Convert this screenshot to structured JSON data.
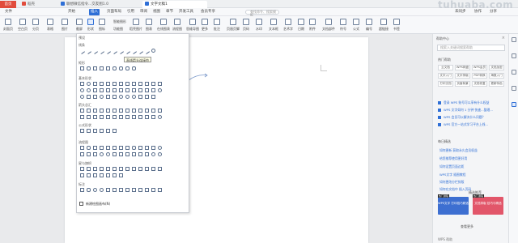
{
  "titlebar": {
    "wps_label": "首页",
    "tabs": [
      {
        "label": "稻壳",
        "color": "#e14c3c"
      },
      {
        "label": "联想微信指令...交友图1.0",
        "color": "#2f6fd6"
      },
      {
        "label": "文字文稿1",
        "color": "#2f6fd6",
        "active": true
      }
    ]
  },
  "watermark": "tuhuaba.com",
  "menubar": {
    "items": [
      "文件",
      "开始",
      "插入",
      "页面布局",
      "引用",
      "审阅",
      "视图",
      "章节",
      "开发工具",
      "会员专享"
    ],
    "active_index": 2,
    "search_placeholder": "查找命令、搜索模板",
    "right_items": [
      "未同步",
      "协作",
      "分享"
    ]
  },
  "toolbar": {
    "tools": [
      {
        "label": "封面页"
      },
      {
        "label": "空白页"
      },
      {
        "label": "分页"
      },
      {
        "label": "表格"
      },
      {
        "label": "图片"
      },
      {
        "label": "截屏"
      },
      {
        "label": "形状",
        "active": true
      },
      {
        "label": "图标"
      },
      {
        "label": "稻壳图片"
      },
      {
        "label": "图表"
      },
      {
        "label": "在线图表"
      },
      {
        "label": "流程图"
      },
      {
        "label": "思维导图"
      },
      {
        "label": "更多"
      },
      {
        "label": "批注"
      },
      {
        "label": "页眉页脚"
      },
      {
        "label": "页码"
      },
      {
        "label": "水印"
      },
      {
        "label": "文本框"
      },
      {
        "label": "艺术字"
      },
      {
        "label": "日期"
      },
      {
        "label": "附件"
      },
      {
        "label": "文档部件"
      },
      {
        "label": "符号"
      },
      {
        "label": "公式"
      },
      {
        "label": "编号"
      },
      {
        "label": "超链接"
      },
      {
        "label": "书签"
      }
    ],
    "small_items": [
      "智能图形",
      "功能图"
    ]
  },
  "shape_panel": {
    "sections": [
      "预设",
      "线条",
      "矩形",
      "基本形状",
      "箭头总汇",
      "公式形状",
      "流程图",
      "星与旗帜",
      "标注"
    ],
    "tooltip": "直线箭头连接符",
    "new_canvas": "新建绘图画布(N)"
  },
  "help_panel": {
    "title": "帮助中心",
    "search_placeholder": "搜索入关键词搜索帮助",
    "section_hot": "热门帮助",
    "chips": [
      "云文档",
      "WPS网盘",
      "WPS会员",
      "文档加密",
      "文字入门",
      "文字排版",
      "PDF转换",
      "海报入门",
      "打印文档",
      "页面背景",
      "文档恢复",
      "更新特色"
    ],
    "qa": [
      "登录 WPS 账号可以享有什么权益",
      "WPS 文字如何 1 分钟 快速...整理...",
      "WPS 会员可以解决什么问题？",
      "WPS 官方一站式学习平台上线..."
    ],
    "section_tips": "每日精选",
    "tips": [
      "如何更新 获取永久会员权益",
      "给您推荐使用更好用",
      "如何设置页面边距",
      "WPS文字 插图教程",
      "如何更改分栏排版",
      "如何在文档中 插入页码"
    ],
    "section_course": "精选推荐",
    "banners": [
      {
        "text": "WPS文字 打印技巧精选",
        "tag": "热门课程",
        "color": "#3d6fd1"
      },
      {
        "text": "文档排版 技巧与精选",
        "tag": "热门课程",
        "color": "#e2566a"
      }
    ],
    "more": "查看更多",
    "bottom": "WPS 帮助"
  },
  "colors": {
    "accent": "#2f6fd6",
    "wps_red": "#e14c3c"
  }
}
